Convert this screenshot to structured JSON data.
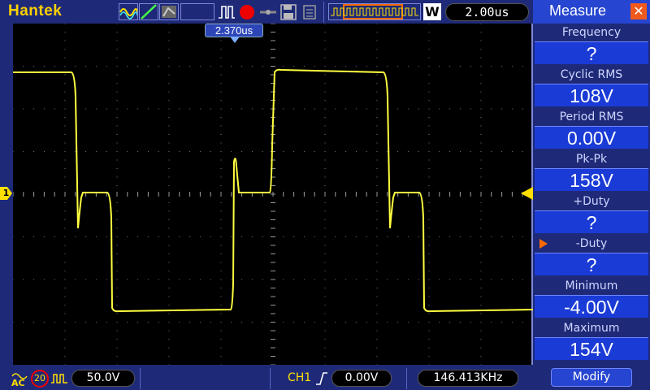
{
  "header": {
    "brand": "Hantek",
    "timebase": "2.00us",
    "window_mode_label": "W"
  },
  "screen": {
    "trigger_position_label": "2.370us",
    "channel_marker_label": "1"
  },
  "panel": {
    "title": "Measure",
    "items": [
      {
        "label": "Frequency",
        "value": "?"
      },
      {
        "label": "Cyclic RMS",
        "value": "108V"
      },
      {
        "label": "Period RMS",
        "value": "0.00V"
      },
      {
        "label": "Pk-Pk",
        "value": "158V"
      },
      {
        "label": "+Duty",
        "value": "?"
      },
      {
        "label": "-Duty",
        "value": "?"
      },
      {
        "label": "Minimum",
        "value": "-4.00V"
      },
      {
        "label": "Maximum",
        "value": "154V"
      }
    ],
    "selected_index": 5,
    "modify_label": "Modify"
  },
  "footer": {
    "coupling": "AC",
    "bw_limit": "20",
    "volts_div": "50.0V",
    "trigger_channel": "CH1",
    "trigger_level": "0.00V",
    "frequency": "146.413KHz"
  },
  "colors": {
    "trace": "#ffff40",
    "background": "#1e2a78",
    "accent": "#2645d0",
    "close": "#f05a1e",
    "brand": "#ffd000"
  }
}
